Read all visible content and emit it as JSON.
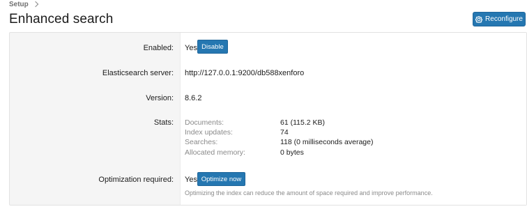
{
  "breadcrumb": {
    "items": [
      "Setup"
    ]
  },
  "header": {
    "title": "Enhanced search",
    "reconfigure_label": "Reconfigure"
  },
  "rows": {
    "enabled": {
      "label": "Enabled:",
      "value": "Yes",
      "button": "Disable"
    },
    "server": {
      "label": "Elasticsearch server:",
      "value": "http://127.0.0.1:9200/db588xenforo"
    },
    "version": {
      "label": "Version:",
      "value": "8.6.2"
    },
    "stats": {
      "label": "Stats:",
      "items": [
        {
          "key": "Documents:",
          "value": "61 (115.2 KB)"
        },
        {
          "key": "Index updates:",
          "value": "74"
        },
        {
          "key": "Searches:",
          "value": "118 (0 milliseconds average)"
        },
        {
          "key": "Allocated memory:",
          "value": "0 bytes"
        }
      ]
    },
    "optimization": {
      "label": "Optimization required:",
      "value": "Yes",
      "button": "Optimize now",
      "hint": "Optimizing the index can reduce the amount of space required and improve performance."
    }
  },
  "colors": {
    "button": "#2577b1",
    "panel_bg": "#f5f5f5"
  },
  "icons": {
    "reconfigure": "gear-icon",
    "breadcrumb_separator": "chevron-right-icon"
  }
}
